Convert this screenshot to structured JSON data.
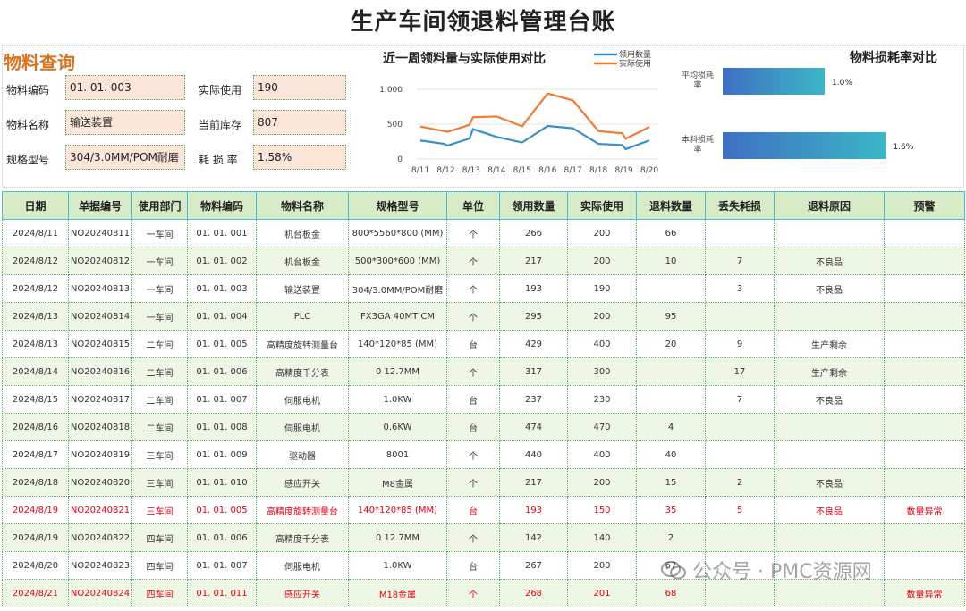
{
  "title": "生产车间领退料管理台账",
  "lookup": {
    "title": "物料查询",
    "code_label": "物料编码",
    "code_value": "01. 01. 003",
    "name_label": "物料名称",
    "name_value": "输送装置",
    "spec_label": "规格型号",
    "spec_value": "304/3.0MM/POM耐磨",
    "actual_label": "实际使用",
    "actual_value": "190",
    "stock_label": "当前库存",
    "stock_value": "807",
    "loss_label": "耗 损 率",
    "loss_value": "1.58%"
  },
  "chart_data": [
    {
      "type": "line",
      "title": "近一周领料量与实际使用对比",
      "x": [
        "8/11",
        "8/12",
        "8/13",
        "8/14",
        "8/15",
        "8/16",
        "8/17",
        "8/18",
        "8/19",
        "8/20"
      ],
      "ylim": [
        0,
        1000
      ],
      "yticks": [
        "0",
        "500",
        "1,000"
      ],
      "legend_position": "top-right",
      "series": [
        {
          "name": "领用数量",
          "color": "#3a8fc8",
          "values": [
            266,
            217,
            193,
            295,
            429,
            317,
            237,
            474,
            440,
            217,
            193,
            142,
            267
          ]
        },
        {
          "name": "实际使用",
          "color": "#ef7a31",
          "values": [
            266,
            217,
            193,
            295,
            429,
            317,
            237,
            474,
            440,
            217,
            193,
            142,
            267
          ]
        }
      ],
      "plotted": {
        "count_note": "",
        "blue": [
          266,
          217,
          193,
          295,
          429,
          317,
          237,
          474,
          440,
          217,
          200,
          142,
          267
        ],
        "orange": [
          466,
          400,
          390,
          490,
          600,
          610,
          470,
          940,
          840,
          400,
          370,
          290,
          460
        ]
      }
    },
    {
      "type": "bar",
      "title": "物料损耗率对比",
      "categories": [
        "平均损耗率",
        "本料损耗率"
      ],
      "values": [
        1.0,
        1.6
      ],
      "value_labels": [
        "1.0%",
        "1.6%"
      ],
      "bar_color_start": "#3e6fc3",
      "bar_color_end": "#3bb7c6"
    }
  ],
  "table": {
    "headers": [
      "日期",
      "单据编号",
      "使用部门",
      "物料编码",
      "物料名称",
      "规格型号",
      "单位",
      "领用数量",
      "实际使用",
      "退料数量",
      "丢失耗损",
      "退料原因",
      "预警"
    ],
    "rows": [
      [
        "2024/8/11",
        "NO20240811",
        "一车间",
        "01. 01. 001",
        "机台板金",
        "800*5560*800 (MM)",
        "个",
        "266",
        "200",
        "66",
        "",
        "",
        ""
      ],
      [
        "2024/8/12",
        "NO20240812",
        "一车间",
        "01. 01. 002",
        "机台板金",
        "500*300*600 (MM)",
        "个",
        "217",
        "200",
        "10",
        "7",
        "不良品",
        ""
      ],
      [
        "2024/8/12",
        "NO20240813",
        "一车间",
        "01. 01. 003",
        "输送装置",
        "304/3.0MM/POM耐磨",
        "个",
        "193",
        "190",
        "",
        "3",
        "不良品",
        ""
      ],
      [
        "2024/8/13",
        "NO20240814",
        "一车间",
        "01. 01. 004",
        "PLC",
        "FX3GA 40MT CM",
        "个",
        "295",
        "200",
        "95",
        "",
        "",
        ""
      ],
      [
        "2024/8/13",
        "NO20240815",
        "二车间",
        "01. 01. 005",
        "高精度旋转测量台",
        "140*120*85 (MM)",
        "台",
        "429",
        "400",
        "20",
        "9",
        "生产剩余",
        ""
      ],
      [
        "2024/8/14",
        "NO20240816",
        "二车间",
        "01. 01. 006",
        "高精度千分表",
        "0 12.7MM",
        "个",
        "317",
        "300",
        "",
        "17",
        "生产剩余",
        ""
      ],
      [
        "2024/8/15",
        "NO20240817",
        "二车间",
        "01. 01. 007",
        "伺服电机",
        "1.0KW",
        "台",
        "237",
        "230",
        "",
        "7",
        "不良品",
        ""
      ],
      [
        "2024/8/16",
        "NO20240818",
        "二车间",
        "01. 01. 008",
        "伺服电机",
        "0.6KW",
        "台",
        "474",
        "470",
        "4",
        "",
        "",
        ""
      ],
      [
        "2024/8/17",
        "NO20240819",
        "三车间",
        "01. 01. 009",
        "驱动器",
        "8001",
        "个",
        "440",
        "400",
        "40",
        "",
        "",
        ""
      ],
      [
        "2024/8/18",
        "NO20240820",
        "三车间",
        "01. 01. 010",
        "感应开关",
        "M8金属",
        "个",
        "217",
        "200",
        "15",
        "2",
        "不良品",
        ""
      ],
      [
        "2024/8/19",
        "NO20240821",
        "三车间",
        "01. 01. 005",
        "高精度旋转测量台",
        "140*120*85 (MM)",
        "台",
        "193",
        "150",
        "35",
        "5",
        "不良品",
        "数量异常"
      ],
      [
        "2024/8/19",
        "NO20240822",
        "四车间",
        "01. 01. 006",
        "高精度千分表",
        "0 12.7MM",
        "个",
        "142",
        "140",
        "2",
        "",
        "",
        ""
      ],
      [
        "2024/8/20",
        "NO20240823",
        "四车间",
        "01. 01. 007",
        "伺服电机",
        "1.0KW",
        "台",
        "267",
        "200",
        "67",
        "",
        "",
        ""
      ],
      [
        "2024/8/21",
        "NO20240824",
        "四车间",
        "01. 01. 011",
        "感应开关",
        "M18金属",
        "个",
        "268",
        "201",
        "68",
        "",
        "",
        "数量异常"
      ]
    ],
    "warn_color": "#e60012"
  },
  "watermark": {
    "text": "公众号 · PMC资源网",
    "icon": "wechat-icon"
  }
}
